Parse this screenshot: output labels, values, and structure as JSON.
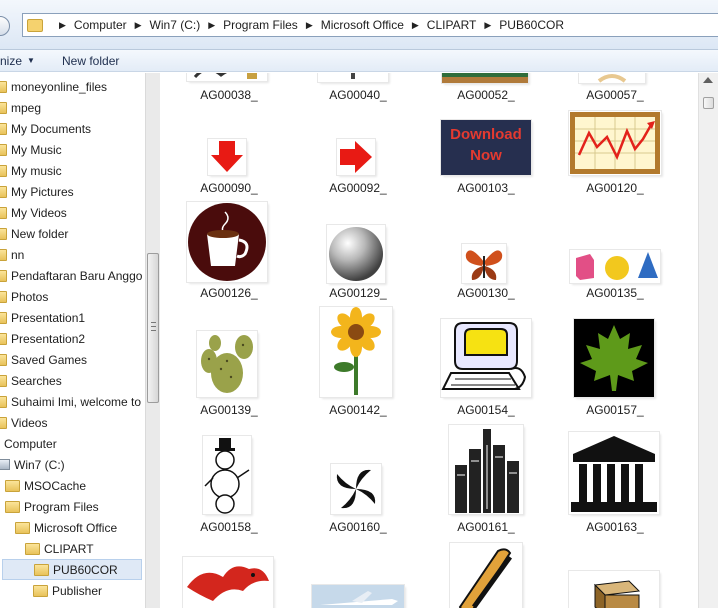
{
  "address": {
    "crumbs": [
      "Computer",
      "Win7 (C:)",
      "Program Files",
      "Microsoft Office",
      "CLIPART",
      "PUB60COR"
    ]
  },
  "toolbar": {
    "organize_label": "nize",
    "new_folder_label": "New folder"
  },
  "sidebar": {
    "items": [
      {
        "label": "moneyonline_files",
        "icon": "folder-icon"
      },
      {
        "label": "mpeg",
        "icon": "folder-icon"
      },
      {
        "label": "My Documents",
        "icon": "folder-icon"
      },
      {
        "label": "My Music",
        "icon": "folder-icon"
      },
      {
        "label": "My music",
        "icon": "folder-icon"
      },
      {
        "label": "My Pictures",
        "icon": "folder-icon"
      },
      {
        "label": "My Videos",
        "icon": "folder-icon"
      },
      {
        "label": "New folder",
        "icon": "folder-icon"
      },
      {
        "label": "nn",
        "icon": "folder-icon"
      },
      {
        "label": "Pendaftaran Baru Anggo",
        "icon": "folder-icon"
      },
      {
        "label": "Photos",
        "icon": "folder-icon"
      },
      {
        "label": "Presentation1",
        "icon": "folder-icon"
      },
      {
        "label": "Presentation2",
        "icon": "folder-icon"
      },
      {
        "label": "Saved Games",
        "icon": "folder-icon"
      },
      {
        "label": "Searches",
        "icon": "folder-icon"
      },
      {
        "label": "Suhaimi Imi, welcome to",
        "icon": "folder-icon"
      },
      {
        "label": "Videos",
        "icon": "folder-icon"
      },
      {
        "label": "Computer",
        "icon": "computer-icon"
      },
      {
        "label": "Win7 (C:)",
        "icon": "drive-icon"
      },
      {
        "label": "MSOCache",
        "icon": "folder-icon"
      },
      {
        "label": "Program Files",
        "icon": "folder-icon"
      },
      {
        "label": "Microsoft Office",
        "icon": "folder-icon"
      },
      {
        "label": "CLIPART",
        "icon": "folder-icon"
      },
      {
        "label": "PUB60COR",
        "icon": "folder-icon",
        "selected": true
      },
      {
        "label": "Publisher",
        "icon": "folder-icon"
      }
    ]
  },
  "files": [
    {
      "name": "AG00038_",
      "icon": "partial-clipart-icon"
    },
    {
      "name": "AG00040_",
      "icon": "partial-clipart-icon"
    },
    {
      "name": "AG00052_",
      "icon": "chalkboard-icon"
    },
    {
      "name": "AG00057_",
      "icon": "partial-clipart-icon"
    },
    {
      "name": "AG00090_",
      "icon": "down-arrow-icon"
    },
    {
      "name": "AG00092_",
      "icon": "right-arrow-icon"
    },
    {
      "name": "AG00103_",
      "icon": "download-now-button-icon",
      "text_line1": "Download",
      "text_line2": "Now"
    },
    {
      "name": "AG00120_",
      "icon": "line-chart-board-icon"
    },
    {
      "name": "AG00126_",
      "icon": "coffee-cup-icon"
    },
    {
      "name": "AG00129_",
      "icon": "silver-sphere-icon"
    },
    {
      "name": "AG00130_",
      "icon": "butterfly-icon"
    },
    {
      "name": "AG00135_",
      "icon": "geometric-shapes-icon"
    },
    {
      "name": "AG00139_",
      "icon": "cactus-icon"
    },
    {
      "name": "AG00142_",
      "icon": "sunflower-icon"
    },
    {
      "name": "AG00154_",
      "icon": "computer-cartoon-icon"
    },
    {
      "name": "AG00157_",
      "icon": "maple-leaf-icon"
    },
    {
      "name": "AG00158_",
      "icon": "snowman-icon"
    },
    {
      "name": "AG00160_",
      "icon": "spiral-icon"
    },
    {
      "name": "AG00161_",
      "icon": "city-skyline-icon"
    },
    {
      "name": "AG00163_",
      "icon": "classical-building-icon"
    },
    {
      "name": "",
      "icon": "dragon-icon"
    },
    {
      "name": "",
      "icon": "airplane-icon"
    },
    {
      "name": "",
      "icon": "hotdog-icon"
    },
    {
      "name": "",
      "icon": "boxes-icon"
    }
  ],
  "colors": {
    "selection": "#dfe9f6",
    "toolbar_bg": "#e3ecf7"
  }
}
